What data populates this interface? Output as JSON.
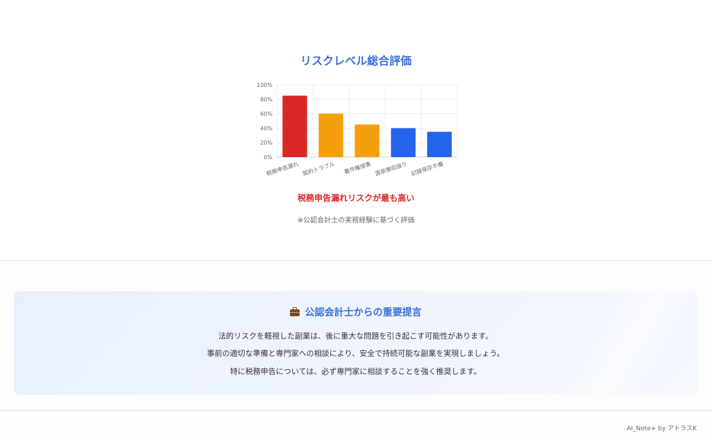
{
  "chart_data": {
    "type": "bar",
    "title": "リスクレベル総合評価",
    "categories": [
      "税務申告漏れ",
      "契約トラブル",
      "著作権侵害",
      "源泉徴収誤り",
      "記録保存不備"
    ],
    "values": [
      85,
      60,
      45,
      40,
      35
    ],
    "colors": [
      "#dc2626",
      "#f59e0b",
      "#f59e0b",
      "#2563eb",
      "#2563eb"
    ],
    "ylim": [
      0,
      100
    ],
    "yticks": [
      "0%",
      "20%",
      "40%",
      "60%",
      "80%",
      "100%"
    ],
    "grid": true,
    "legend": "none"
  },
  "chart_notes": {
    "highlight": "税務申告漏れリスクが最も高い",
    "source": "※公認会計士の実務経験に基づく評価"
  },
  "proposal": {
    "icon": "briefcase-icon",
    "title": "公認会計士からの重要提言",
    "lines": [
      "法的リスクを軽視した副業は、後に重大な問題を引き起こす可能性があります。",
      "事前の適切な準備と専門家への相談により、安全で持続可能な副業を実現しましょう。",
      "特に税務申告については、必ず専門家に相談することを強く推奨します。"
    ]
  },
  "footer": {
    "credit": "AI_Note+ by アトラスK"
  }
}
